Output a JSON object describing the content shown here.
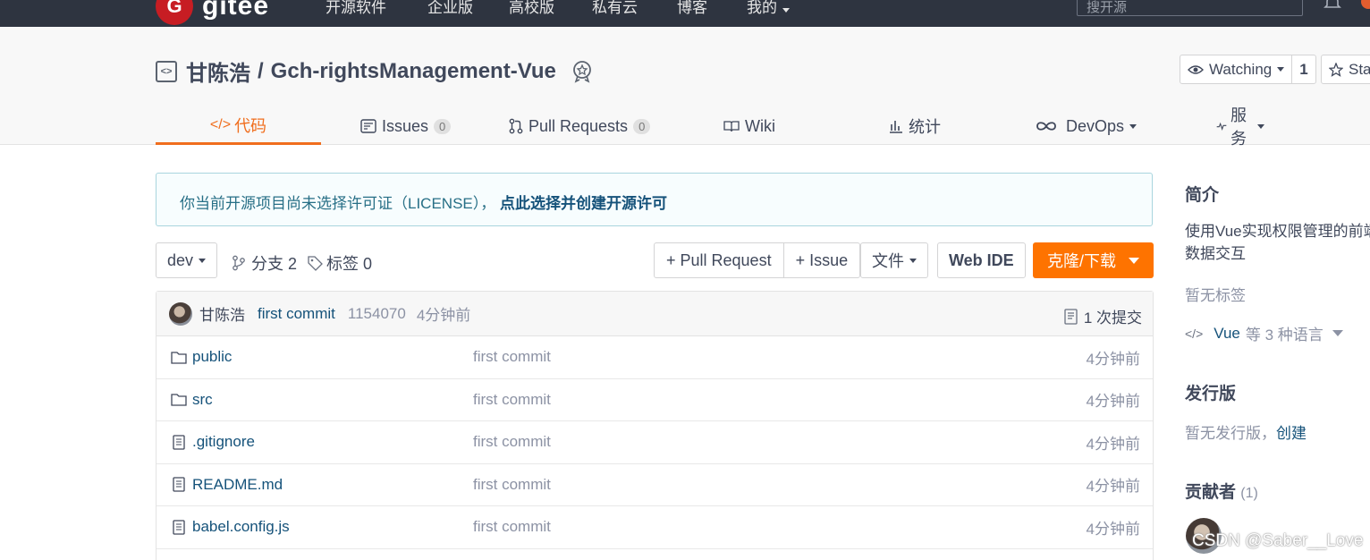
{
  "topnav": {
    "logo_text": "gitee",
    "items": [
      "开源软件",
      "企业版",
      "高校版",
      "私有云",
      "博客",
      "我的"
    ],
    "search_placeholder": "搜开源"
  },
  "repo": {
    "owner": "甘陈浩",
    "separator": "/",
    "name": "Gch-rightsManagement-Vue",
    "watch_label": "Watching",
    "watch_count": "1",
    "star_label": "Star"
  },
  "tabs": [
    {
      "label": "代码"
    },
    {
      "label": "Issues",
      "count": "0"
    },
    {
      "label": "Pull Requests",
      "count": "0"
    },
    {
      "label": "Wiki"
    },
    {
      "label": "统计"
    },
    {
      "label": "DevOps"
    },
    {
      "label": "服务"
    }
  ],
  "notice": {
    "text": "你当前开源项目尚未选择许可证（LICENSE），",
    "link": "点此选择并创建开源许可"
  },
  "toolbar": {
    "branch": "dev",
    "branches": "分支 2",
    "tags": "标签 0",
    "pull_request": "+ Pull Request",
    "issue": "+ Issue",
    "file": "文件",
    "web_ide": "Web IDE",
    "clone": "克隆/下载"
  },
  "commit": {
    "author": "甘陈浩",
    "message": "first commit",
    "sha": "1154070",
    "time": "4分钟前",
    "count": "1 次提交"
  },
  "files": [
    {
      "type": "folder",
      "name": "public",
      "commit": "first commit",
      "time": "4分钟前"
    },
    {
      "type": "folder",
      "name": "src",
      "commit": "first commit",
      "time": "4分钟前"
    },
    {
      "type": "file",
      "name": ".gitignore",
      "commit": "first commit",
      "time": "4分钟前"
    },
    {
      "type": "file",
      "name": "README.md",
      "commit": "first commit",
      "time": "4分钟前"
    },
    {
      "type": "file",
      "name": "babel.config.js",
      "commit": "first commit",
      "time": "4分钟前"
    }
  ],
  "sidebar": {
    "intro_title": "简介",
    "intro_line1": "使用Vue实现权限管理的前端",
    "intro_line2": "数据交互",
    "no_tags": "暂无标签",
    "language": "Vue",
    "language_suffix": "等 3 种语言",
    "release_title": "发行版",
    "no_release": "暂无发行版，",
    "create_link": "创建",
    "contrib_title": "贡献者",
    "contrib_count": "(1)"
  },
  "watermark": "CSDN @Saber__Love",
  "colors": {
    "accent": "#f06e1e",
    "clone_button": "#fe7300",
    "link": "#15527a",
    "topnav_bg": "#2e3440"
  }
}
